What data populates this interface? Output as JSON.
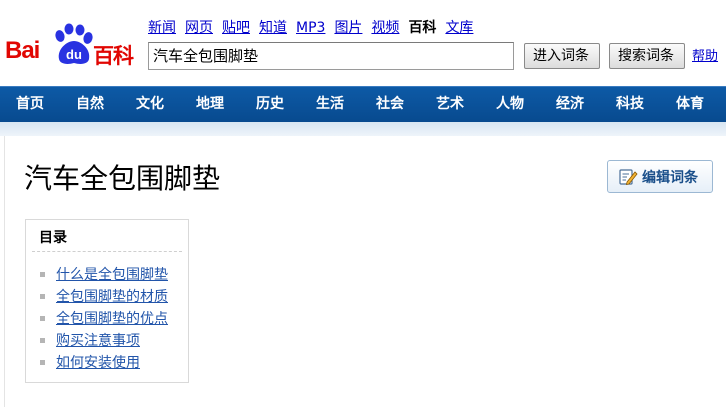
{
  "logo": {
    "bai": "Bai",
    "du": "du",
    "baike": "百科"
  },
  "toplinks": [
    {
      "label": "新闻",
      "current": false
    },
    {
      "label": "网页",
      "current": false
    },
    {
      "label": "贴吧",
      "current": false
    },
    {
      "label": "知道",
      "current": false
    },
    {
      "label": "MP3",
      "current": false
    },
    {
      "label": "图片",
      "current": false
    },
    {
      "label": "视频",
      "current": false
    },
    {
      "label": "百科",
      "current": true
    },
    {
      "label": "文库",
      "current": false
    }
  ],
  "search": {
    "value": "汽车全包围脚垫",
    "enter_label": "进入词条",
    "search_label": "搜索词条",
    "help_label": "帮助"
  },
  "nav": [
    "首页",
    "自然",
    "文化",
    "地理",
    "历史",
    "生活",
    "社会",
    "艺术",
    "人物",
    "经济",
    "科技",
    "体育"
  ],
  "article": {
    "title": "汽车全包围脚垫",
    "edit_label": "编辑词条"
  },
  "toc": {
    "title": "目录",
    "items": [
      "什么是全包围脚垫",
      "全包围脚垫的材质",
      "全包围脚垫的优点",
      "购买注意事项",
      "如何安装使用"
    ]
  },
  "colors": {
    "brand_red": "#e10602",
    "brand_blue": "#2932e1",
    "nav_blue": "#0b559f",
    "link": "#0000cc"
  }
}
